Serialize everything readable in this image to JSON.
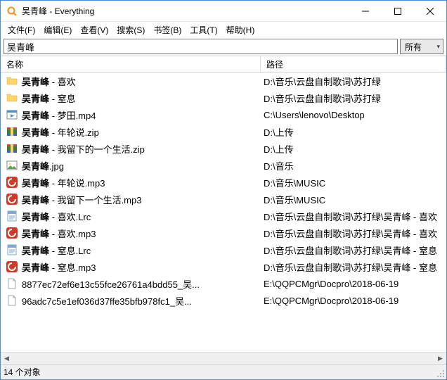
{
  "title": "吴青峰 - Everything",
  "menu": [
    "文件(F)",
    "编辑(E)",
    "查看(V)",
    "搜索(S)",
    "书签(B)",
    "工具(T)",
    "帮助(H)"
  ],
  "search": {
    "value": "吴青峰",
    "filter": "所有"
  },
  "columns": {
    "name": "名称",
    "path": "路径"
  },
  "query_bold": "吴青峰",
  "rows": [
    {
      "icon": "folder",
      "name": "吴青峰 - 喜欢",
      "path": "D:\\音乐\\云盘自制歌词\\苏打绿"
    },
    {
      "icon": "folder",
      "name": "吴青峰 - 窒息",
      "path": "D:\\音乐\\云盘自制歌词\\苏打绿"
    },
    {
      "icon": "video",
      "name": "吴青峰 - 梦田.mp4",
      "path": "C:\\Users\\lenovo\\Desktop"
    },
    {
      "icon": "archive",
      "name": "吴青峰 - 年轮说.zip",
      "path": "D:\\上传"
    },
    {
      "icon": "archive",
      "name": "吴青峰 - 我留下的一个生活.zip",
      "path": "D:\\上传"
    },
    {
      "icon": "image",
      "name": "吴青峰.jpg",
      "path": "D:\\音乐"
    },
    {
      "icon": "music",
      "name": "吴青峰 - 年轮说.mp3",
      "path": "D:\\音乐\\MUSIC"
    },
    {
      "icon": "music",
      "name": "吴青峰 - 我留下一个生活.mp3",
      "path": "D:\\音乐\\MUSIC"
    },
    {
      "icon": "lrc",
      "name": "吴青峰 - 喜欢.Lrc",
      "path": "D:\\音乐\\云盘自制歌词\\苏打绿\\吴青峰 - 喜欢"
    },
    {
      "icon": "music",
      "name": "吴青峰 - 喜欢.mp3",
      "path": "D:\\音乐\\云盘自制歌词\\苏打绿\\吴青峰 - 喜欢"
    },
    {
      "icon": "lrc",
      "name": "吴青峰 - 窒息.Lrc",
      "path": "D:\\音乐\\云盘自制歌词\\苏打绿\\吴青峰 - 窒息"
    },
    {
      "icon": "music",
      "name": "吴青峰 - 窒息.mp3",
      "path": "D:\\音乐\\云盘自制歌词\\苏打绿\\吴青峰 - 窒息"
    },
    {
      "icon": "file",
      "name": "8877ec72ef6e13c55fce26761a4bdd55_吴...",
      "path": "E:\\QQPCMgr\\Docpro\\2018-06-19"
    },
    {
      "icon": "file",
      "name": "96adc7c5e1ef036d37ffe35bfb978fc1_吴...",
      "path": "E:\\QQPCMgr\\Docpro\\2018-06-19"
    }
  ],
  "status": "14 个对象"
}
